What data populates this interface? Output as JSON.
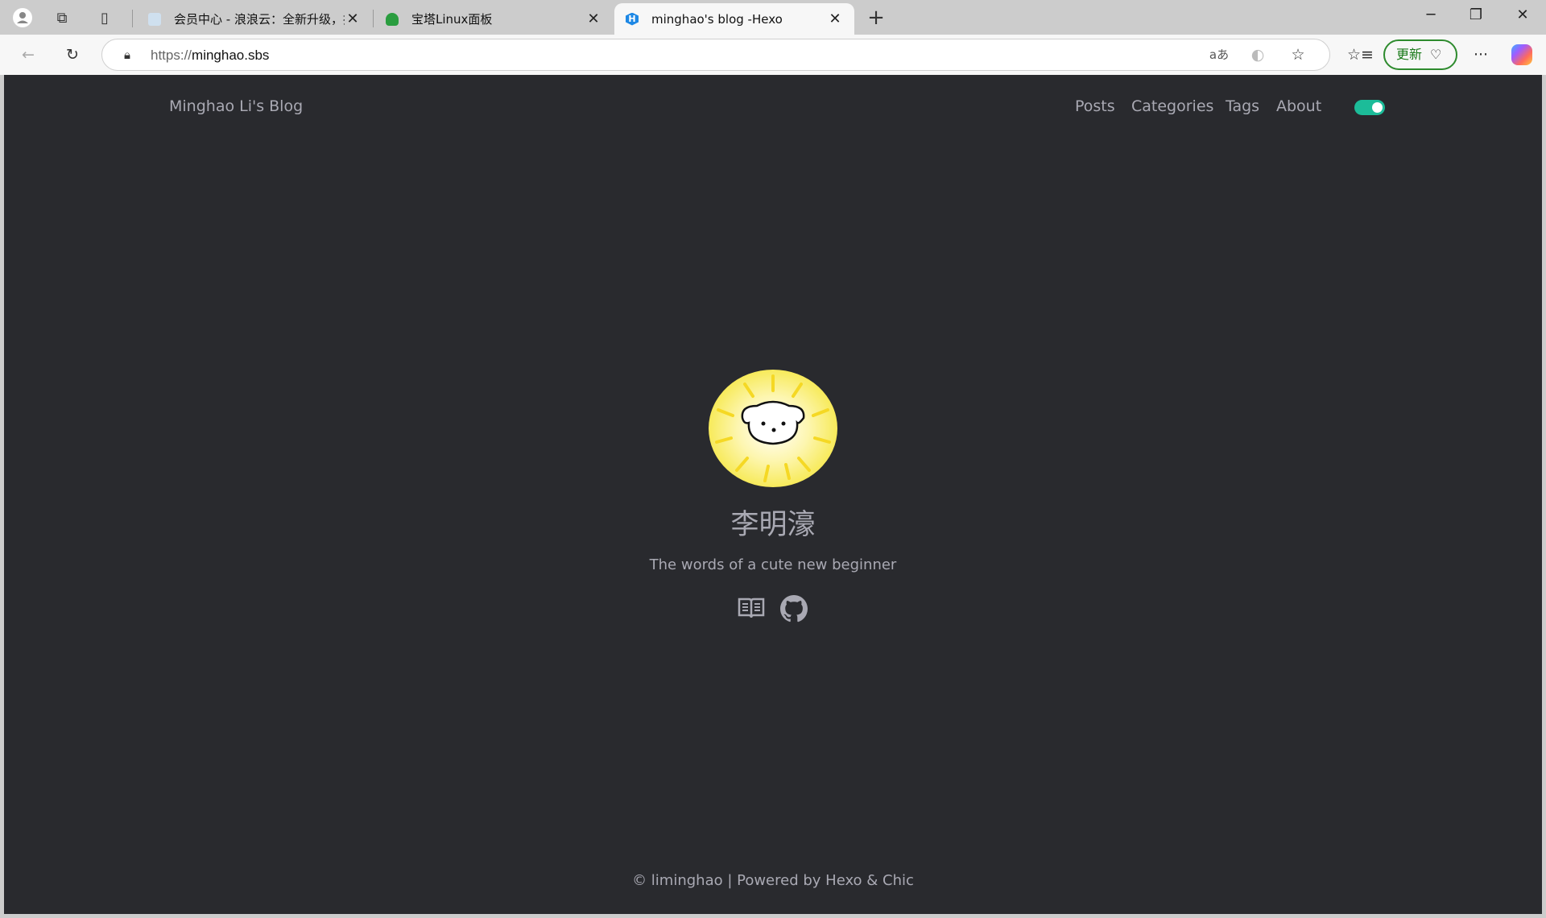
{
  "browser": {
    "tabs": [
      {
        "title": "会员中心 - 浪浪云：全新升级，提",
        "active": false
      },
      {
        "title": "宝塔Linux面板",
        "active": false
      },
      {
        "title": "minghao's blog -Hexo",
        "active": true
      }
    ],
    "url_scheme": "https://",
    "url_host": "minghao.sbs",
    "update_label": "更新"
  },
  "site": {
    "brand": "Minghao Li's Blog",
    "nav": [
      "Posts",
      "Categories",
      "Tags",
      "About"
    ],
    "theme_toggle_on": true,
    "accent_color": "#1cbc99",
    "background_color": "#292a2e",
    "text_color": "#a9a9b3"
  },
  "profile": {
    "name": "李明濠",
    "description": "The words of a cute new beginner",
    "social_icons": [
      "book-icon",
      "github-icon"
    ]
  },
  "footer": {
    "text": "© liminghao | Powered by Hexo & Chic"
  }
}
